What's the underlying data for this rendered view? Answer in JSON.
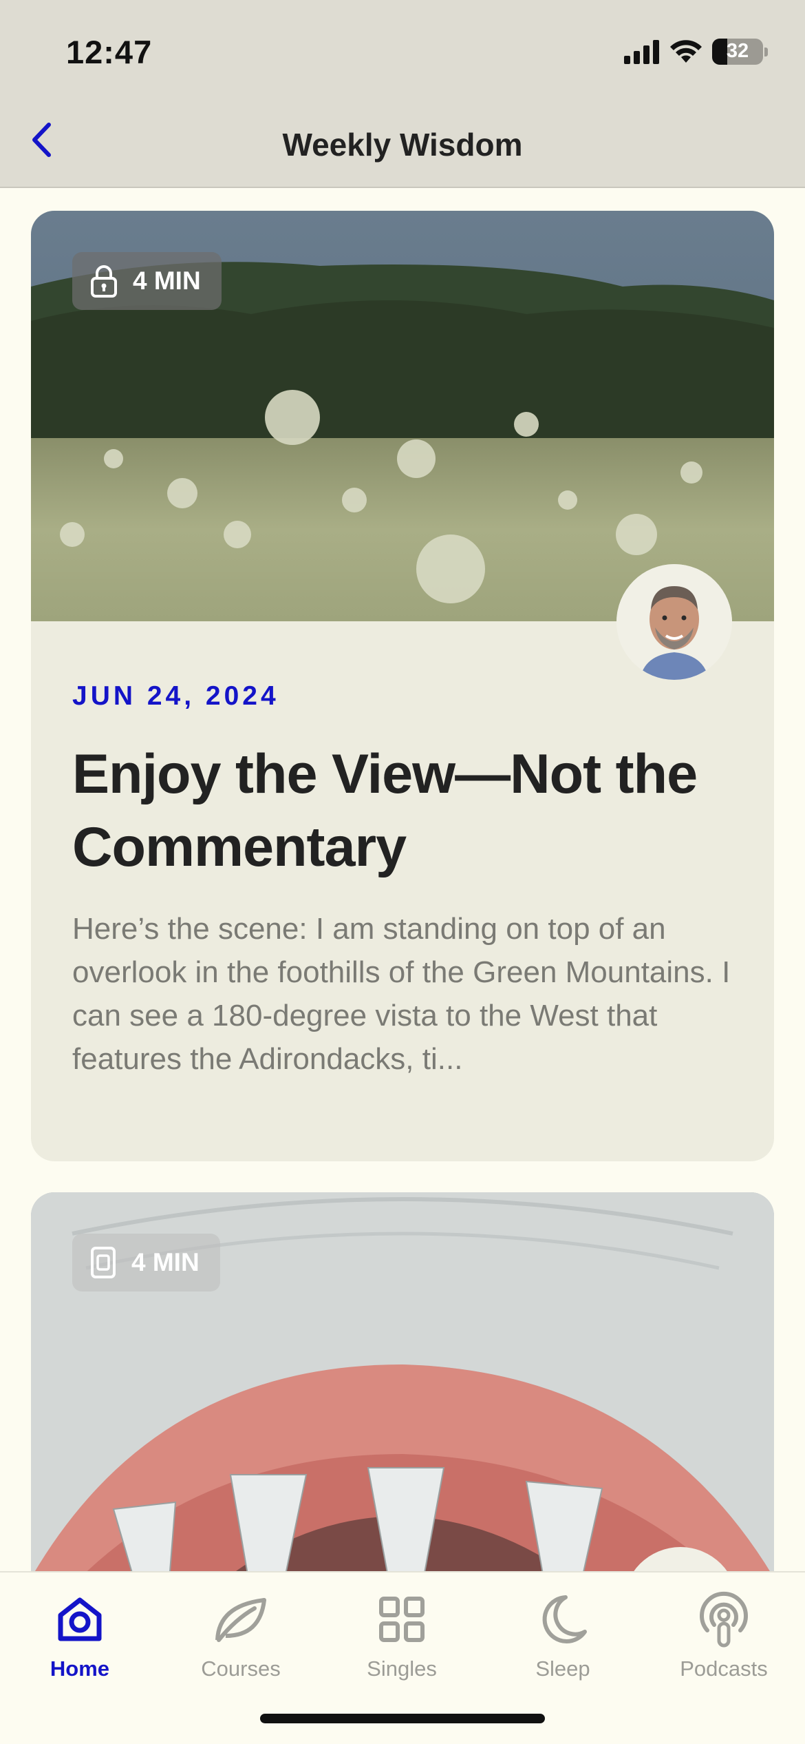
{
  "status_bar": {
    "time": "12:47",
    "battery": "32"
  },
  "header": {
    "title": "Weekly Wisdom"
  },
  "cards": [
    {
      "duration": "4 MIN",
      "date": "JUN 24, 2024",
      "title": "Enjoy the View—Not the Commentary",
      "excerpt": "Here’s the scene: I am standing on top of an overlook in the foothills of the Green Mountains. I can see a 180-degree vista to the West that features the Adirondacks, ti..."
    },
    {
      "duration": "4 MIN"
    }
  ],
  "tabs": [
    {
      "label": "Home",
      "icon": "home-icon"
    },
    {
      "label": "Courses",
      "icon": "leaf-icon"
    },
    {
      "label": "Singles",
      "icon": "grid-icon"
    },
    {
      "label": "Sleep",
      "icon": "moon-icon"
    },
    {
      "label": "Podcasts",
      "icon": "podcast-icon"
    }
  ],
  "colors": {
    "accent": "#1414c8",
    "background": "#fdfcf1",
    "card": "#edecdf",
    "header": "#dedcd2"
  }
}
